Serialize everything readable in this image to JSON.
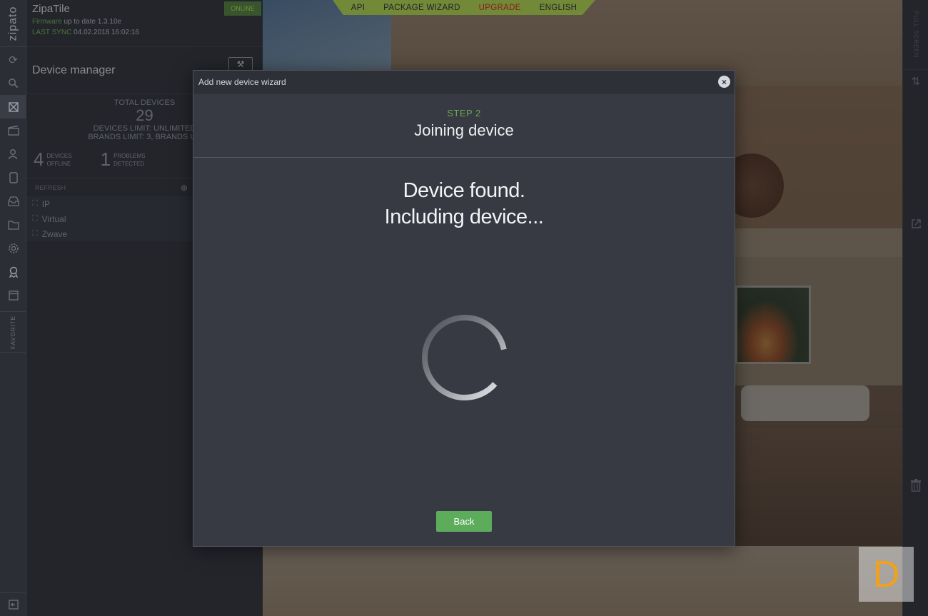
{
  "top_menu": {
    "items": [
      "API",
      "PACKAGE WIZARD",
      "UPGRADE",
      "ENGLISH"
    ]
  },
  "brand": {
    "logo_text": "zipato"
  },
  "controller": {
    "name": "ZipaTile",
    "status": "ONLINE",
    "firmware_label": "Firmware",
    "firmware_text": "up to date 1.3.10e",
    "last_sync_label": "LAST SYNC",
    "last_sync_value": "04.02.2018 16:02:16"
  },
  "device_manager": {
    "title": "Device manager",
    "total_label": "TOTAL DEVICES",
    "total_value": "29",
    "devices_limit": "DEVICES LIMIT: UNLIMITED",
    "brands_limit": "BRANDS LIMIT: 3, BRANDS US",
    "offline_count": "4",
    "offline_label_1": "DEVICES",
    "offline_label_2": "OFFLINE",
    "problems_count": "1",
    "problems_label_1": "PROBLEMS",
    "problems_label_2": "DETECTED",
    "refresh_label": "REFRESH",
    "tree": [
      "IP",
      "Virtual",
      "Zwave"
    ]
  },
  "sidebar": {
    "favorite_label": "FAVORITE"
  },
  "rightbar": {
    "fullscreen_label": "FULL SCREEN"
  },
  "wizard": {
    "title": "Add new device wizard",
    "step_label": "STEP 2",
    "step_title": "Joining device",
    "message_line1": "Device found.",
    "message_line2": "Including device...",
    "back_label": "Back"
  },
  "watermark": {
    "letter": "D"
  },
  "colors": {
    "accent_green": "#6aa84f",
    "button_green": "#5cac5c",
    "menu_green": "#a8c94a",
    "upgrade_red": "#c62828",
    "watermark_orange": "#f2a11b"
  }
}
